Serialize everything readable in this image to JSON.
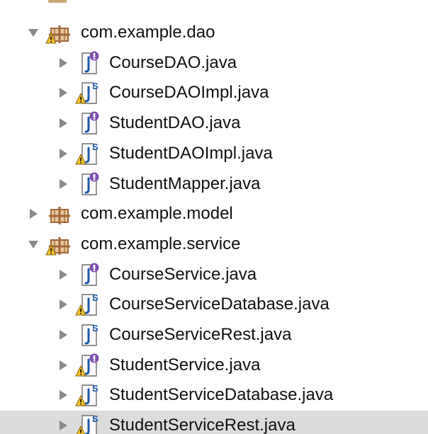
{
  "tree": {
    "items": [
      {
        "label": "com.example.dao",
        "kind": "package",
        "expanded": true,
        "depth": 0,
        "warning": true,
        "icon": "package-icon"
      },
      {
        "label": "CourseDAO.java",
        "kind": "interface",
        "depth": 1,
        "warning": false,
        "icon": "java-interface-icon"
      },
      {
        "label": "CourseDAOImpl.java",
        "kind": "class",
        "depth": 1,
        "warning": true,
        "icon": "java-class-icon"
      },
      {
        "label": "StudentDAO.java",
        "kind": "interface",
        "depth": 1,
        "warning": false,
        "icon": "java-interface-icon"
      },
      {
        "label": "StudentDAOImpl.java",
        "kind": "class",
        "depth": 1,
        "warning": true,
        "icon": "java-class-icon"
      },
      {
        "label": "StudentMapper.java",
        "kind": "interface",
        "depth": 1,
        "warning": false,
        "icon": "java-interface-icon"
      },
      {
        "label": "com.example.model",
        "kind": "package",
        "expanded": false,
        "depth": 0,
        "warning": false,
        "icon": "package-icon"
      },
      {
        "label": "com.example.service",
        "kind": "package",
        "expanded": true,
        "depth": 0,
        "warning": true,
        "icon": "package-icon"
      },
      {
        "label": "CourseService.java",
        "kind": "interface",
        "depth": 1,
        "warning": false,
        "icon": "java-interface-icon"
      },
      {
        "label": "CourseServiceDatabase.java",
        "kind": "class",
        "depth": 1,
        "warning": true,
        "icon": "java-class-icon"
      },
      {
        "label": "CourseServiceRest.java",
        "kind": "class",
        "depth": 1,
        "warning": false,
        "icon": "java-class-icon"
      },
      {
        "label": "StudentService.java",
        "kind": "interface",
        "depth": 1,
        "warning": true,
        "icon": "java-interface-icon"
      },
      {
        "label": "StudentServiceDatabase.java",
        "kind": "class",
        "depth": 1,
        "warning": true,
        "icon": "java-class-icon"
      },
      {
        "label": "StudentServiceRest.java",
        "kind": "class",
        "depth": 1,
        "warning": true,
        "selected": true,
        "icon": "java-class-icon"
      }
    ]
  },
  "colors": {
    "selection": "#dcdcdc",
    "chevron": "#8a8a8a",
    "package_brown": "#a0683a",
    "interface_purple": "#7d4fb0",
    "class_blue": "#1e5aa8",
    "warning_yellow": "#f2c12e"
  }
}
